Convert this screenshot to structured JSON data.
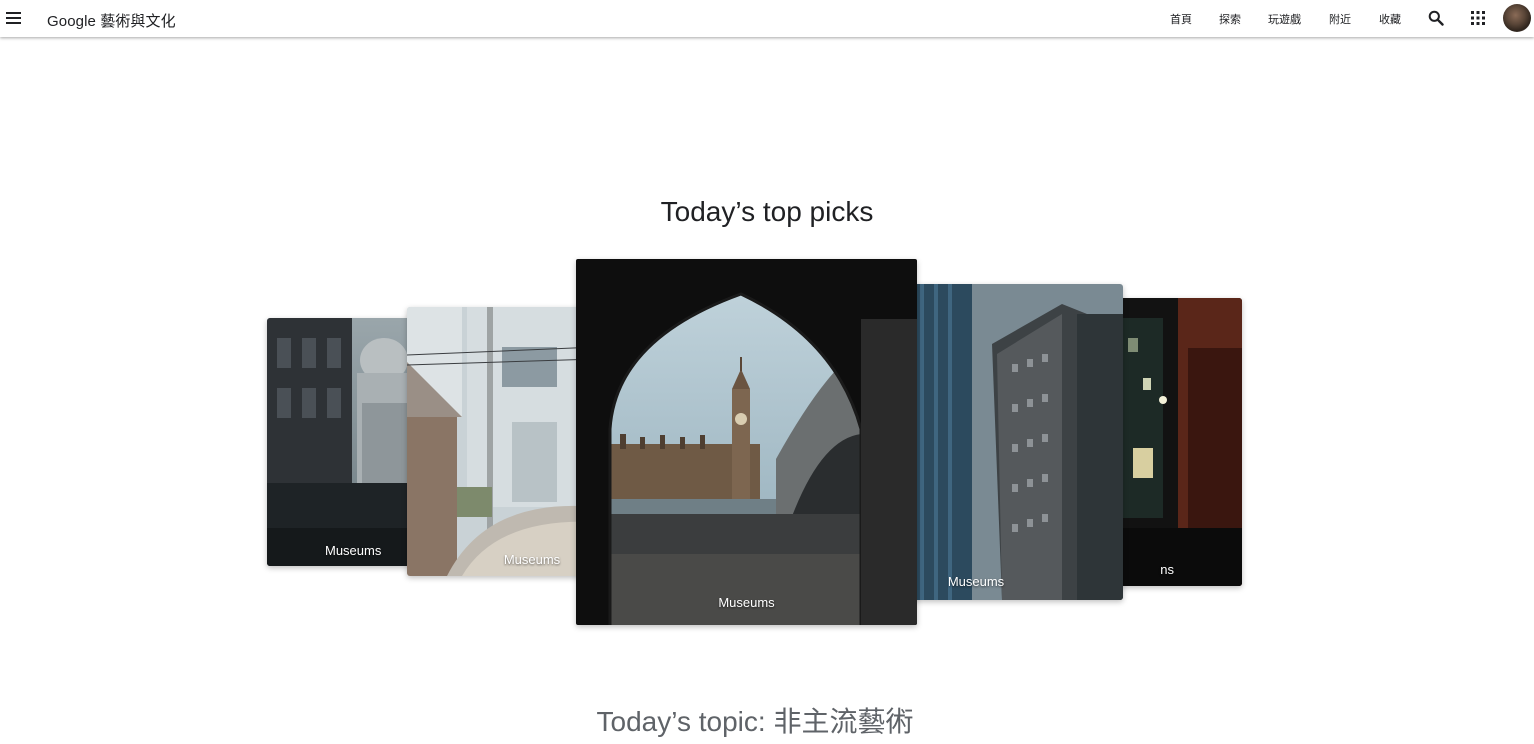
{
  "header": {
    "brand": "Google 藝術與文化",
    "nav": [
      "首頁",
      "探索",
      "玩遊戲",
      "附近",
      "收藏"
    ]
  },
  "main": {
    "top_picks_title": "Today’s top picks",
    "cards": [
      {
        "caption": "Museums"
      },
      {
        "caption": "Museums"
      },
      {
        "caption": "Museums"
      },
      {
        "caption": "Museums"
      },
      {
        "caption": "ns"
      }
    ],
    "topic_title": "Today’s topic: 非主流藝術"
  }
}
